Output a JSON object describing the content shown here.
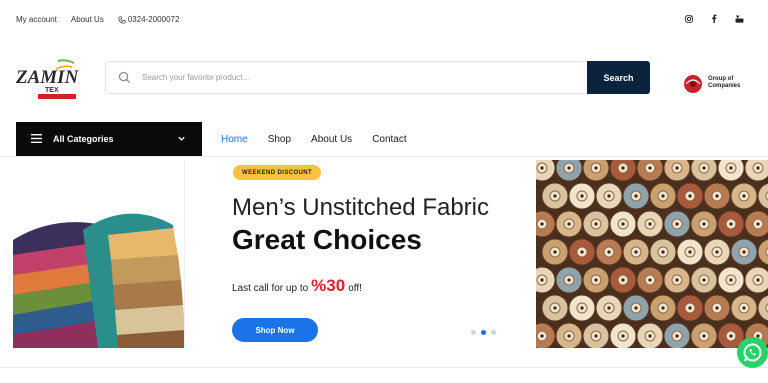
{
  "topbar": {
    "my_account": "My account",
    "about_us": "About Us",
    "phone": "0324-2000072",
    "social_icons": [
      "instagram-icon",
      "facebook-icon",
      "youtube-icon"
    ]
  },
  "header": {
    "logo_text": "ZAMIN",
    "logo_sub": "TEX",
    "search_placeholder": "Search your favorite product...",
    "search_button": "Search",
    "group_logo_line1": "Group of",
    "group_logo_line2": "Companies"
  },
  "nav": {
    "all_categories": "All Categories",
    "items": [
      "Home",
      "Shop",
      "About Us",
      "Contact"
    ],
    "active": "Home"
  },
  "banner": {
    "badge": "WEEKEND DISCOUNT",
    "headline": "Men’s Unstitched Fabric",
    "subheadline": "Great Choices",
    "promo_prefix": "Last call for up to",
    "promo_value": "%30",
    "promo_suffix": "off!",
    "cta": "Shop Now",
    "slide_count": 3,
    "active_slide": 2
  },
  "colors": {
    "accent": "#1a73e8",
    "search_button": "#0c2340",
    "badge": "#f7c23e",
    "discount": "#e0202e",
    "whatsapp": "#25d366"
  }
}
